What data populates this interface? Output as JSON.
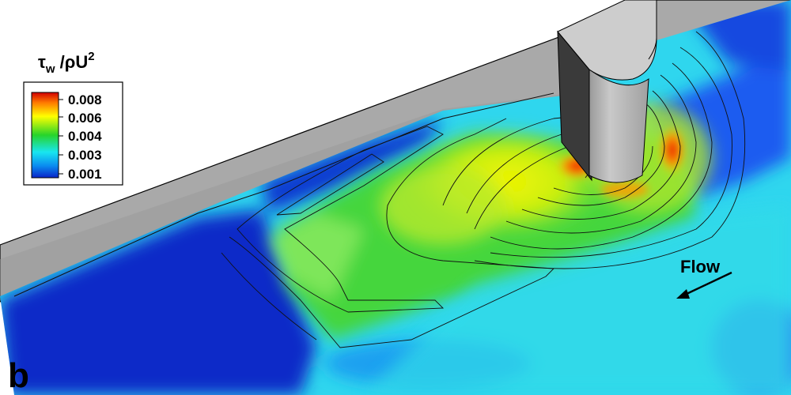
{
  "figure": {
    "panel_label": "b",
    "flow_label": "Flow"
  },
  "legend": {
    "title": {
      "symbol": "τ",
      "subscript": "w",
      "divider": " /ρU",
      "superscript": "2"
    },
    "levels": [
      "0.008",
      "0.006",
      "0.004",
      "0.003",
      "0.001"
    ],
    "colors": {
      "high": "#d10000",
      "upper": "#ffff00",
      "mid": "#27d42a",
      "lower": "#19e6f0",
      "low": "#0a24c8"
    }
  },
  "colors": {
    "wall_top": "#a8a8a8",
    "wall_face": "#8e8e8e",
    "pier_light": "#cfcfcf",
    "pier_dark": "#3b3b3b",
    "background": "#ffffff"
  }
}
